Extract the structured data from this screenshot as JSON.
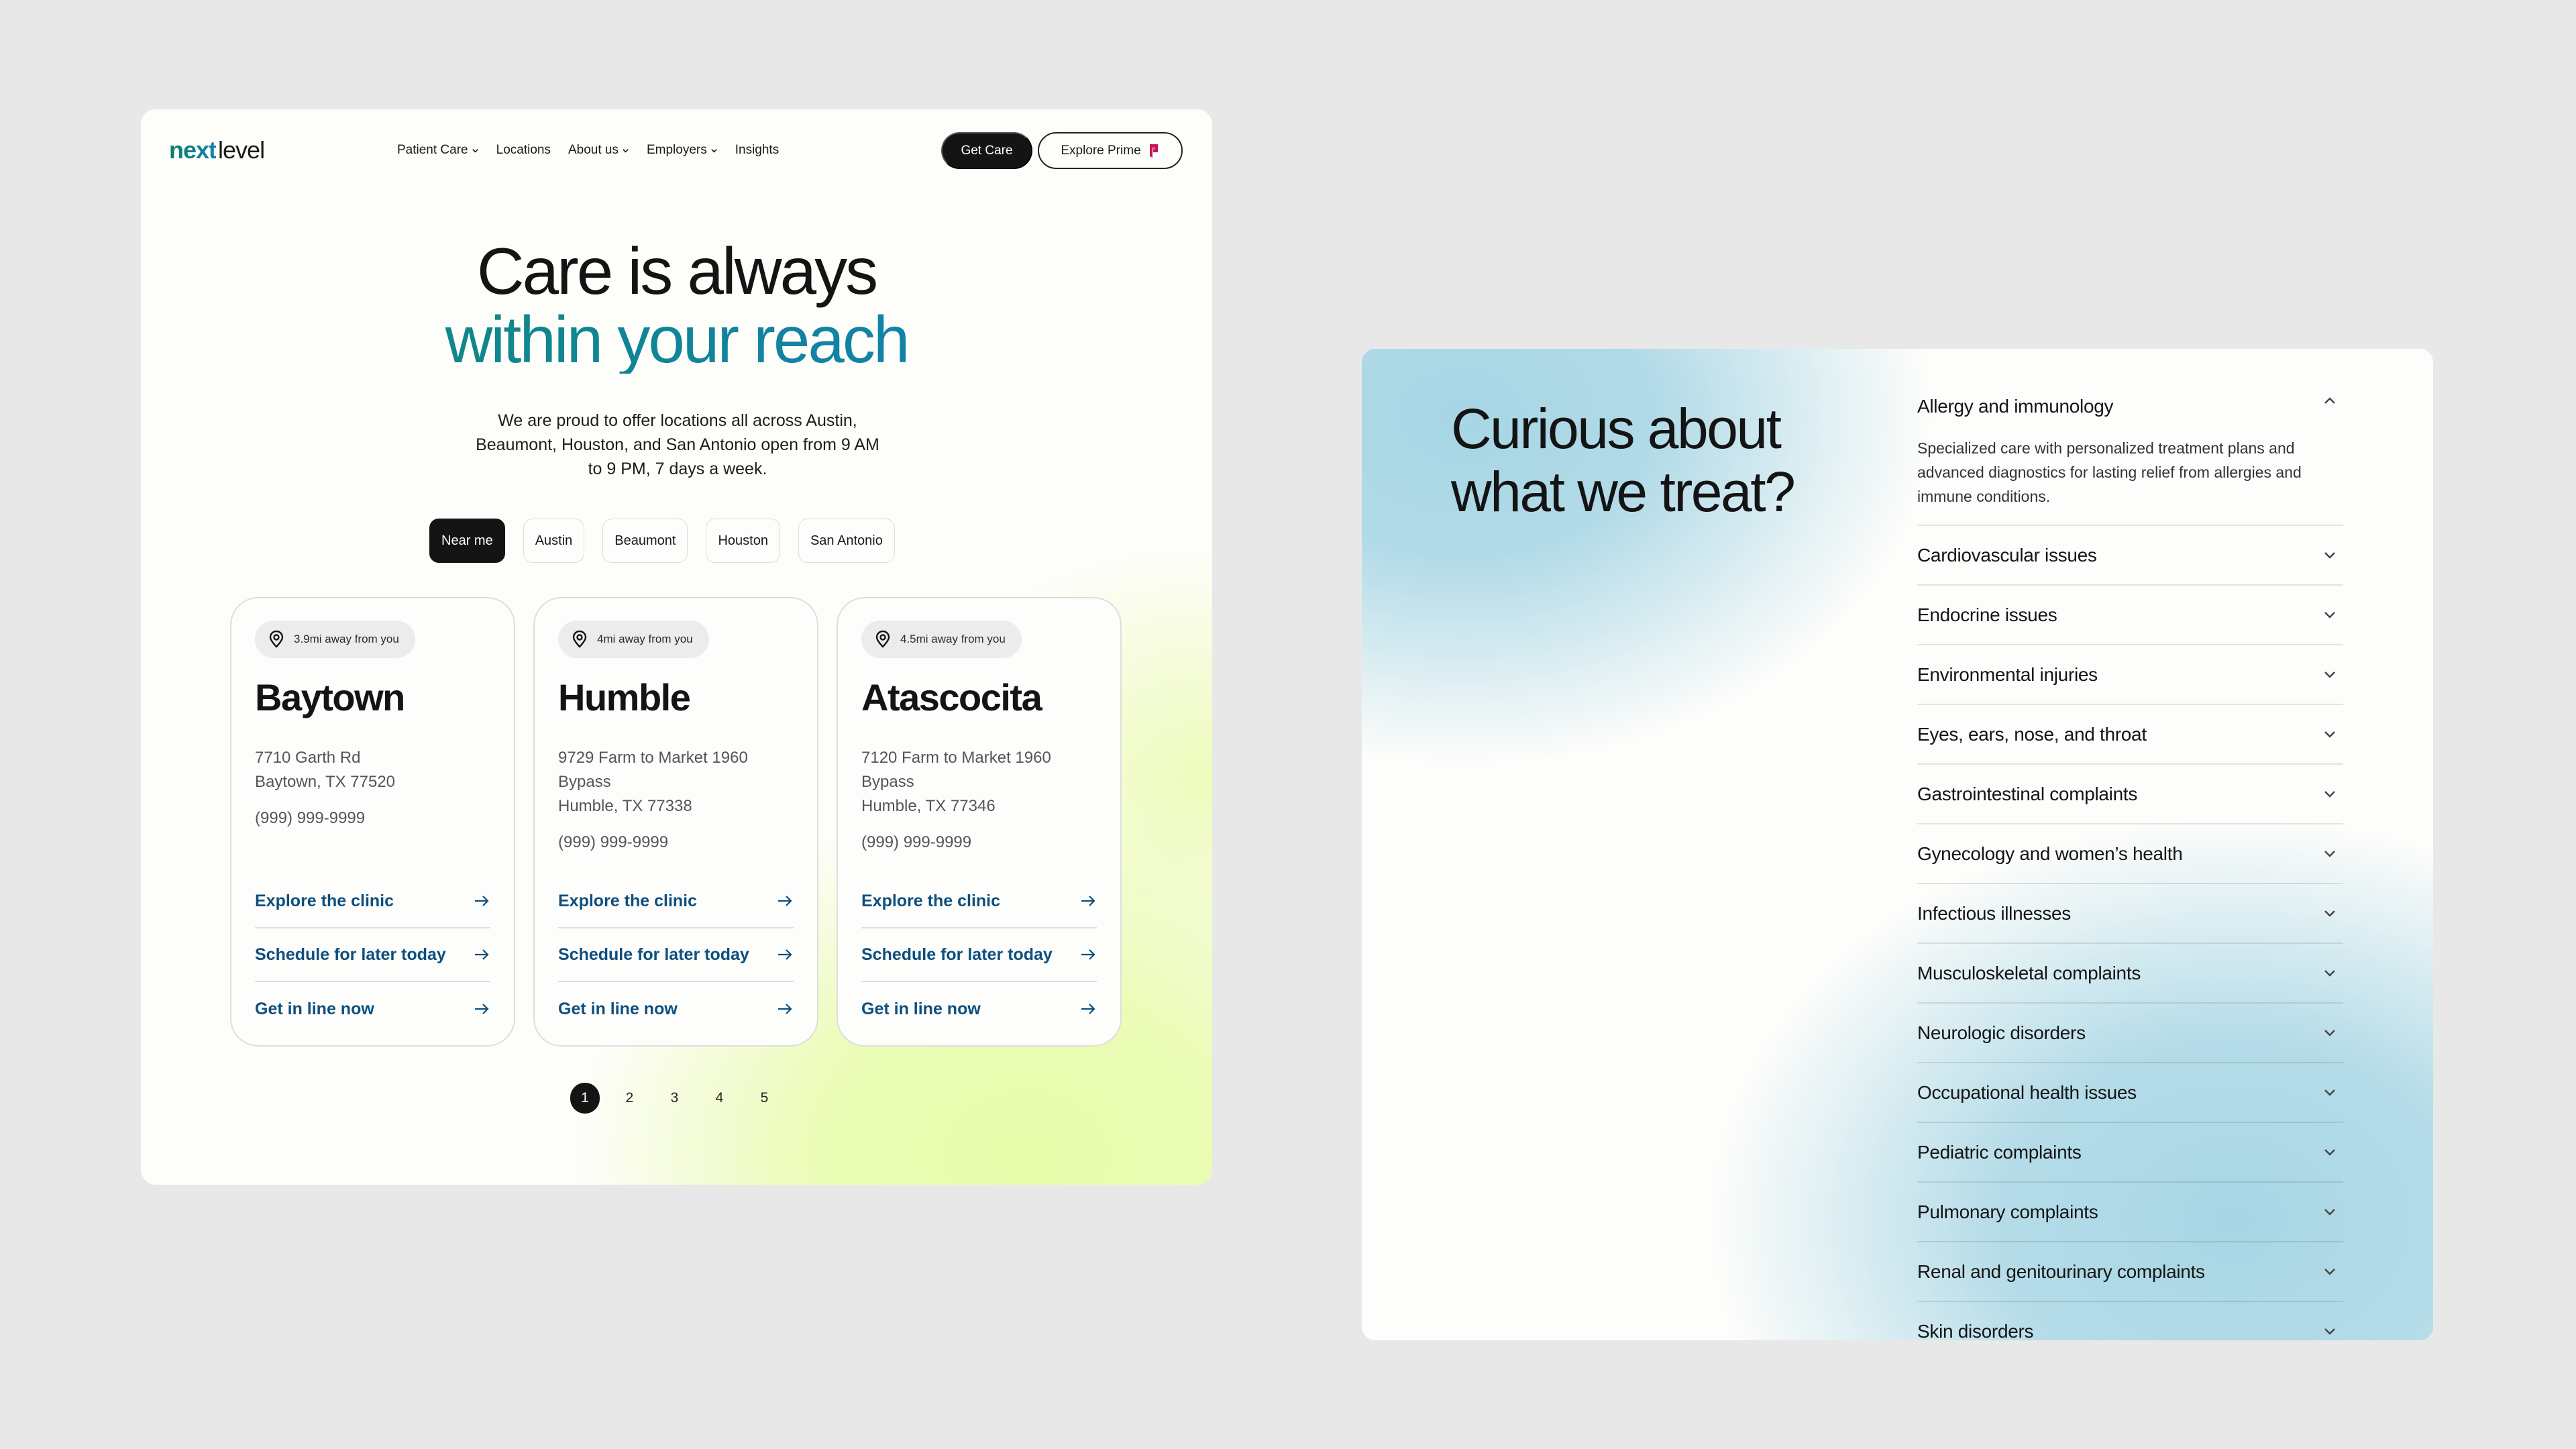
{
  "left_page": {
    "logo": {
      "part1": "next",
      "part2": "level"
    },
    "nav": [
      {
        "label": "Patient Care",
        "dropdown": true
      },
      {
        "label": "Locations",
        "dropdown": false
      },
      {
        "label": "About us",
        "dropdown": true
      },
      {
        "label": "Employers",
        "dropdown": true
      },
      {
        "label": "Insights",
        "dropdown": false
      }
    ],
    "get_care_label": "Get Care",
    "explore_prime_label": "Explore Prime",
    "hero": {
      "line1": "Care is always",
      "line2": "within your reach",
      "subtitle": "We are proud to offer locations all across Austin, Beaumont, Houston, and San Antonio open from 9 AM to 9 PM, 7 days a week."
    },
    "filters": [
      {
        "label": "Near me",
        "active": true
      },
      {
        "label": "Austin",
        "active": false
      },
      {
        "label": "Beaumont",
        "active": false
      },
      {
        "label": "Houston",
        "active": false
      },
      {
        "label": "San Antonio",
        "active": false
      }
    ],
    "clinics": [
      {
        "distance": "3.9mi away from you",
        "name": "Baytown",
        "address": [
          "7710 Garth Rd",
          "Baytown, TX 77520"
        ],
        "phone": "(999) 999-9999",
        "links": [
          "Explore the clinic",
          "Schedule for later today",
          "Get in line now"
        ]
      },
      {
        "distance": "4mi away from you",
        "name": "Humble",
        "address": [
          "9729 Farm to Market 1960",
          "Bypass",
          "Humble, TX 77338"
        ],
        "phone": "(999) 999-9999",
        "links": [
          "Explore the clinic",
          "Schedule for later today",
          "Get in line now"
        ]
      },
      {
        "distance": "4.5mi away from you",
        "name": "Atascocita",
        "address": [
          "7120 Farm to Market 1960",
          "Bypass",
          "Humble, TX 77346"
        ],
        "phone": "(999) 999-9999",
        "links": [
          "Explore the clinic",
          "Schedule for later today",
          "Get in line now"
        ]
      }
    ],
    "pagination": {
      "pages": [
        "1",
        "2",
        "3",
        "4",
        "5"
      ],
      "current": "1"
    }
  },
  "right_page": {
    "title_line1": "Curious about",
    "title_line2": "what we treat?",
    "conditions": [
      {
        "label": "Allergy and immunology",
        "open": true,
        "description": "Specialized care with personalized treatment plans and advanced diagnostics for lasting relief from allergies and immune conditions."
      },
      {
        "label": "Cardiovascular issues",
        "open": false
      },
      {
        "label": "Endocrine issues",
        "open": false
      },
      {
        "label": "Environmental injuries",
        "open": false
      },
      {
        "label": "Eyes, ears, nose, and throat",
        "open": false
      },
      {
        "label": "Gastrointestinal complaints",
        "open": false
      },
      {
        "label": "Gynecology and women’s health",
        "open": false
      },
      {
        "label": "Infectious illnesses",
        "open": false
      },
      {
        "label": "Musculoskeletal complaints",
        "open": false
      },
      {
        "label": "Neurologic disorders",
        "open": false
      },
      {
        "label": "Occupational health issues",
        "open": false
      },
      {
        "label": "Pediatric complaints",
        "open": false
      },
      {
        "label": "Pulmonary complaints",
        "open": false
      },
      {
        "label": "Renal and genitourinary complaints",
        "open": false
      },
      {
        "label": "Skin disorders",
        "open": false
      }
    ]
  },
  "colors": {
    "brand_teal": "#0f8a74",
    "brand_blue": "#137fbf",
    "link_blue": "#0d4f7e",
    "dark": "#141414",
    "lime_glow": "#e8fcaa",
    "sky_glow": "#a8d6e5"
  }
}
